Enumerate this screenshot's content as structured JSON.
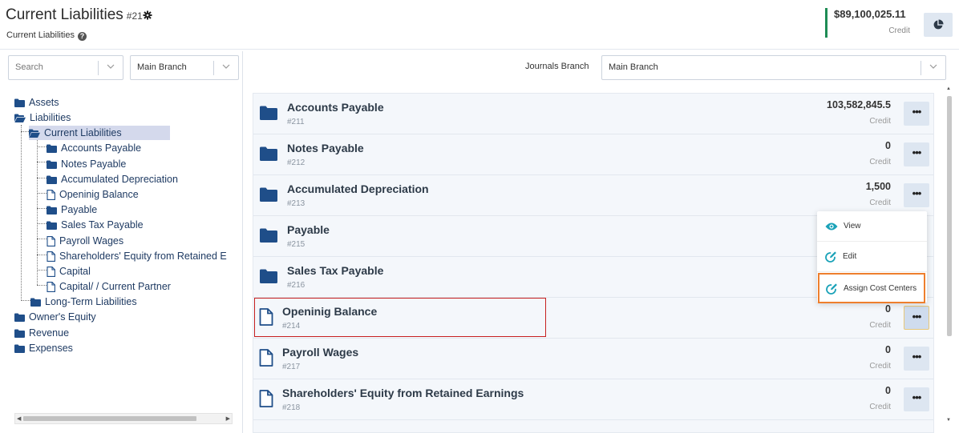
{
  "header": {
    "title": "Current Liabilities",
    "number": "#21",
    "subtitle": "Current Liabilities",
    "balance": "$89,100,025.11",
    "balance_label": "Credit"
  },
  "sidebar": {
    "search_placeholder": "Search",
    "branch_value": "Main Branch",
    "tree": [
      {
        "label": "Assets",
        "icon": "folder-icon"
      },
      {
        "label": "Liabilities",
        "icon": "folder-open-icon"
      },
      {
        "label": "Current Liabilities",
        "icon": "folder-open-icon"
      },
      {
        "label": "Accounts Payable",
        "icon": "folder-icon"
      },
      {
        "label": "Notes Payable",
        "icon": "folder-icon"
      },
      {
        "label": "Accumulated Depreciation",
        "icon": "folder-icon"
      },
      {
        "label": "Openinig Balance",
        "icon": "file-icon"
      },
      {
        "label": "Payable",
        "icon": "folder-icon"
      },
      {
        "label": "Sales Tax Payable",
        "icon": "folder-icon"
      },
      {
        "label": "Payroll Wages",
        "icon": "file-icon"
      },
      {
        "label": "Shareholders' Equity from Retained E",
        "icon": "file-icon"
      },
      {
        "label": "Capital",
        "icon": "file-icon"
      },
      {
        "label": "Capital/ / Current Partner",
        "icon": "file-icon"
      },
      {
        "label": "Long-Term Liabilities",
        "icon": "folder-icon"
      },
      {
        "label": "Owner's Equity",
        "icon": "folder-icon"
      },
      {
        "label": "Revenue",
        "icon": "folder-icon"
      },
      {
        "label": "Expenses",
        "icon": "folder-icon"
      }
    ]
  },
  "main": {
    "journals_branch_label": "Journals Branch",
    "journals_branch_value": "Main Branch",
    "accounts": [
      {
        "name": "Accounts Payable",
        "code": "#211",
        "value": "103,582,845.5",
        "type": "Credit",
        "icon": "folder-icon"
      },
      {
        "name": "Notes Payable",
        "code": "#212",
        "value": "0",
        "type": "Credit",
        "icon": "folder-icon"
      },
      {
        "name": "Accumulated Depreciation",
        "code": "#213",
        "value": "1,500",
        "type": "Credit",
        "icon": "folder-icon"
      },
      {
        "name": "Payable",
        "code": "#215",
        "value": "",
        "type": "",
        "icon": "folder-icon"
      },
      {
        "name": "Sales Tax Payable",
        "code": "#216",
        "value": "",
        "type": "",
        "icon": "folder-icon"
      },
      {
        "name": "Openinig Balance",
        "code": "#214",
        "value": "0",
        "type": "Credit",
        "icon": "file-icon"
      },
      {
        "name": "Payroll Wages",
        "code": "#217",
        "value": "0",
        "type": "Credit",
        "icon": "file-icon"
      },
      {
        "name": "Shareholders' Equity from Retained Earnings",
        "code": "#218",
        "value": "0",
        "type": "Credit",
        "icon": "file-icon"
      }
    ],
    "more_label": "•••"
  },
  "context_menu": {
    "items": [
      {
        "label": "View",
        "icon": "eye-icon"
      },
      {
        "label": "Edit",
        "icon": "edit-icon"
      },
      {
        "label": "Assign Cost Centers",
        "icon": "edit-icon"
      }
    ]
  },
  "colors": {
    "folder": "#1f4e89",
    "accent_green": "#1e8c55",
    "menu_icon": "#1aa2b8",
    "highlight_orange": "#ee7f2d",
    "highlight_red": "#c62020"
  }
}
